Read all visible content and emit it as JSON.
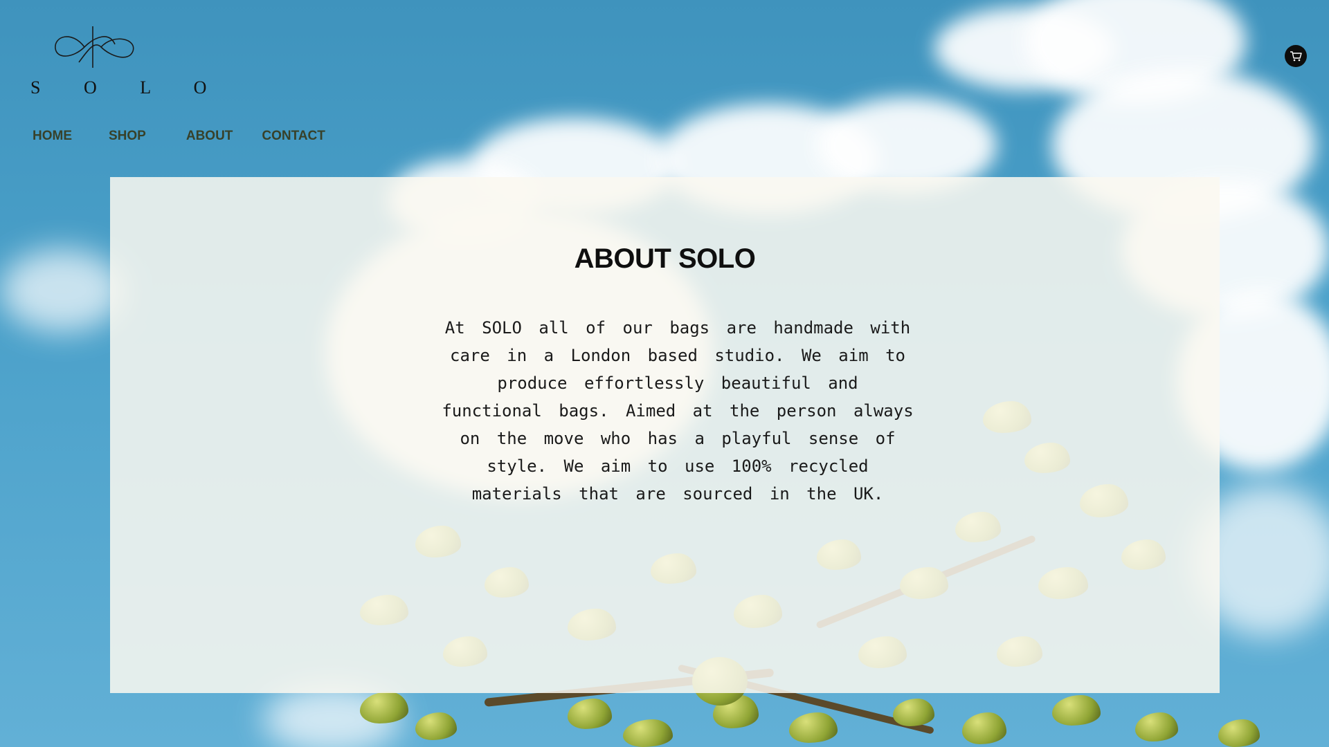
{
  "brand": {
    "name": "S O L O"
  },
  "nav": {
    "items": [
      {
        "label": "HOME"
      },
      {
        "label": "SHOP"
      },
      {
        "label": "ABOUT"
      },
      {
        "label": "CONTACT"
      }
    ]
  },
  "header": {
    "cart_icon": "cart-icon"
  },
  "about": {
    "title": "ABOUT SOLO",
    "body": "At SOLO all of our bags are handmade with care in a London based studio.  We aim to produce effortlessly beautiful and functional bags.  Aimed at the person always on the move who has a playful sense of style.  We aim to use 100% recycled materials that are sourced in the UK."
  },
  "colors": {
    "sky": "#4aa0c9",
    "panel": "#faf8f0",
    "nav_text": "#37412a",
    "title_text": "#0f0f0f"
  }
}
